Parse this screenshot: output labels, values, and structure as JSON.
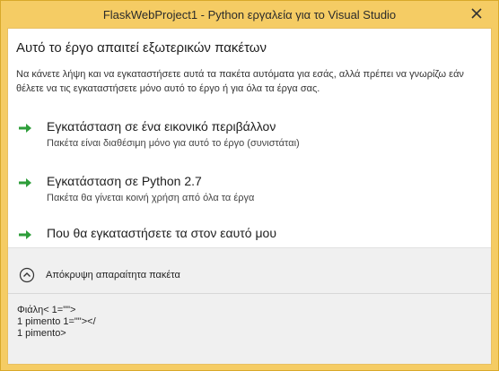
{
  "window": {
    "title": "FlaskWebProject1 - Python εργαλεία για το Visual Studio"
  },
  "content": {
    "heading": "Αυτό το έργο απαιτεί εξωτερικών πακέτων",
    "description": "Να κάνετε λήψη και να εγκαταστήσετε αυτά τα πακέτα αυτόματα για εσάς, αλλά πρέπει να γνωρίζω εάν θέλετε να τις εγκαταστήσετε μόνο αυτό το έργο ή για όλα τα έργα σας."
  },
  "options": [
    {
      "title": "Εγκατάσταση σε ένα εικονικό περιβάλλον",
      "subtitle": "Πακέτα είναι διαθέσιμη μόνο για αυτό το έργο (συνιστάται)"
    },
    {
      "title": "Εγκατάσταση σε Python 2.7",
      "subtitle": "Πακέτα θα γίνεται κοινή χρήση από όλα τα έργα"
    },
    {
      "title": "Που θα εγκαταστήσετε τα στον εαυτό μου",
      "subtitle": ""
    }
  ],
  "toggle": {
    "label": "Απόκρυψη απαραίτητα πακέτα"
  },
  "packages": {
    "lines": [
      "Φιάλη< 1=\"\">",
      "1 pimento 1=\"\"></",
      "1 pimento>"
    ]
  },
  "colors": {
    "frame": "#f5cc64",
    "arrow": "#2e9e3a"
  },
  "icons": {
    "close": "close-icon",
    "arrow": "arrow-right-icon",
    "collapse": "chevron-up-circle-icon"
  }
}
